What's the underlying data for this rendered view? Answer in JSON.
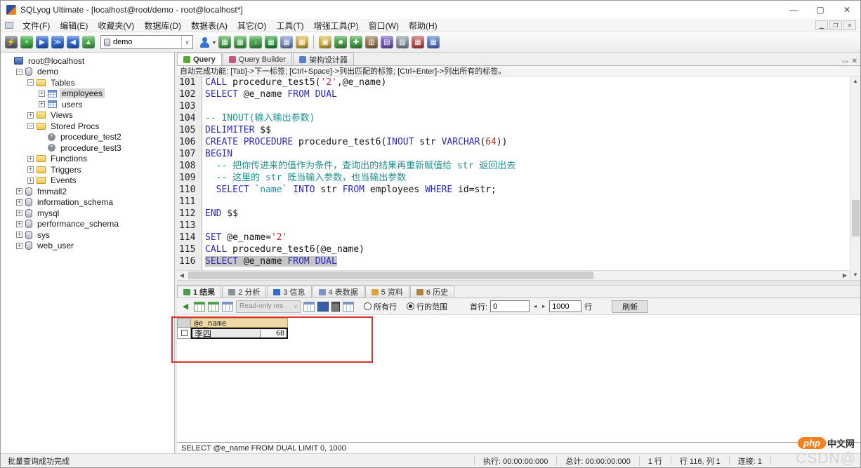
{
  "colors": {
    "keyword": "#2a2ac4",
    "string": "#cc2b2b",
    "number": "#99332b",
    "comment": "#1d8f8f",
    "backtick": "#1d8f8f",
    "selection_bg": "#c6c6c6",
    "grid_header_bg": "#f0d9a8",
    "annotation_red": "#d9342e",
    "php_orange": "#f4801f"
  },
  "titlebar": {
    "title": "SQLyog Ultimate - [localhost@root/demo - root@localhost*]",
    "controls": {
      "minimize": "—",
      "maximize": "▢",
      "close": "✕"
    }
  },
  "menubar": {
    "items": [
      "文件(F)",
      "编辑(E)",
      "收藏夹(V)",
      "数据库(D)",
      "数据表(A)",
      "其它(O)",
      "工具(T)",
      "增强工具(P)",
      "窗口(W)",
      "帮助(H)"
    ],
    "mdi_controls": [
      "▁",
      "❐",
      "✕"
    ]
  },
  "toolbar": {
    "db_selector_value": "demo",
    "icons_left": [
      {
        "name": "open-connection-icon",
        "glyph": "⚡",
        "color": "#6b6f77"
      },
      {
        "name": "new-connection-icon",
        "glyph": "+",
        "color": "#3faf46"
      },
      {
        "name": "execute-query-icon",
        "glyph": "▶",
        "color": "#2f6bd8"
      },
      {
        "name": "execute-all-icon",
        "glyph": "≫",
        "color": "#2f6bd8"
      },
      {
        "name": "refresh-icon",
        "glyph": "◀",
        "color": "#2f6bd8"
      },
      {
        "name": "chart-icon",
        "glyph": "▲",
        "color": "#4caf50"
      }
    ],
    "icons_mid": [
      {
        "name": "insert-row-icon",
        "glyph": "▦",
        "color": "#49a84d"
      },
      {
        "name": "duplicate-row-icon",
        "glyph": "▦",
        "color": "#49a84d"
      },
      {
        "name": "import-icon",
        "glyph": "↓",
        "color": "#49a84d"
      },
      {
        "name": "export-table-icon",
        "glyph": "▦",
        "color": "#2e9e44"
      },
      {
        "name": "table-grid-icon",
        "glyph": "▦",
        "color": "#7d93c6"
      },
      {
        "name": "schema-grid-icon",
        "glyph": "▦",
        "color": "#d8b74a"
      }
    ],
    "icons_right": [
      {
        "name": "backup-icon",
        "glyph": "▣",
        "color": "#d8b74a"
      },
      {
        "name": "user-manager-icon",
        "glyph": "☻",
        "color": "#49a84d"
      },
      {
        "name": "sync-icon",
        "glyph": "✚",
        "color": "#49a84d"
      },
      {
        "name": "migrate-icon",
        "glyph": "▥",
        "color": "#9a7b4f"
      },
      {
        "name": "scheduler-icon",
        "glyph": "▤",
        "color": "#7a5fc0"
      },
      {
        "name": "snapshot-icon",
        "glyph": "▧",
        "color": "#8d9aa5"
      },
      {
        "name": "format-icon",
        "glyph": "▦",
        "color": "#c05555"
      },
      {
        "name": "compare-icon",
        "glyph": "▦",
        "color": "#5b7fd0"
      }
    ]
  },
  "sidebar": {
    "tree": [
      {
        "label": "root@localhost",
        "level": 0,
        "icon": "server",
        "expand": ""
      },
      {
        "label": "demo",
        "level": 1,
        "icon": "db",
        "expand": "-"
      },
      {
        "label": "Tables",
        "level": 2,
        "icon": "folder",
        "expand": "-"
      },
      {
        "label": "employees",
        "level": 3,
        "icon": "table",
        "expand": "+",
        "selected": true
      },
      {
        "label": "users",
        "level": 3,
        "icon": "table",
        "expand": "+"
      },
      {
        "label": "Views",
        "level": 2,
        "icon": "folder",
        "expand": "+"
      },
      {
        "label": "Stored Procs",
        "level": 2,
        "icon": "folder",
        "expand": "-"
      },
      {
        "label": "procedure_test2",
        "level": 3,
        "icon": "proc",
        "expand": ""
      },
      {
        "label": "procedure_test3",
        "level": 3,
        "icon": "proc",
        "expand": ""
      },
      {
        "label": "Functions",
        "level": 2,
        "icon": "folder",
        "expand": "+"
      },
      {
        "label": "Triggers",
        "level": 2,
        "icon": "folder",
        "expand": "+"
      },
      {
        "label": "Events",
        "level": 2,
        "icon": "folder",
        "expand": "+"
      },
      {
        "label": "fmmall2",
        "level": 1,
        "icon": "db",
        "expand": "+"
      },
      {
        "label": "information_schema",
        "level": 1,
        "icon": "db",
        "expand": "+"
      },
      {
        "label": "mysql",
        "level": 1,
        "icon": "db",
        "expand": "+"
      },
      {
        "label": "performance_schema",
        "level": 1,
        "icon": "db",
        "expand": "+"
      },
      {
        "label": "sys",
        "level": 1,
        "icon": "db",
        "expand": "+"
      },
      {
        "label": "web_user",
        "level": 1,
        "icon": "db",
        "expand": "+"
      }
    ]
  },
  "query_tabs": {
    "tabs": [
      {
        "label": "Query",
        "icon": "query-icon",
        "icon_color": "#58a832",
        "active": true
      },
      {
        "label": "Query Builder",
        "icon": "query-builder-icon",
        "icon_color": "#c45b7a",
        "active": false
      },
      {
        "label": "架构设计器",
        "icon": "schema-designer-icon",
        "icon_color": "#5b7fd0",
        "active": false
      }
    ],
    "close_glyph": "✕",
    "nav_glyphs": "◂ ▸"
  },
  "hint": "自动完成功能: [Tab]->下一标签; [Ctrl+Space]->列出匹配的标签; [Ctrl+Enter]->列出所有的标签。",
  "editor": {
    "lines": [
      {
        "num": "101",
        "segs": [
          {
            "t": "CALL",
            "c": "kw"
          },
          {
            "t": " procedure_test5(",
            "c": "pl"
          },
          {
            "t": "'2'",
            "c": "str"
          },
          {
            "t": ",@e_name)",
            "c": "pl"
          }
        ]
      },
      {
        "num": "102",
        "segs": [
          {
            "t": "SELECT",
            "c": "kw"
          },
          {
            "t": " @e_name ",
            "c": "pl"
          },
          {
            "t": "FROM",
            "c": "kw"
          },
          {
            "t": " ",
            "c": "pl"
          },
          {
            "t": "DUAL",
            "c": "kw"
          }
        ]
      },
      {
        "num": "103",
        "segs": []
      },
      {
        "num": "104",
        "segs": [
          {
            "t": "-- INOUT(输入输出参数)",
            "c": "com"
          }
        ]
      },
      {
        "num": "105",
        "segs": [
          {
            "t": "DELIMITER",
            "c": "kw"
          },
          {
            "t": " $$",
            "c": "pl"
          }
        ]
      },
      {
        "num": "106",
        "segs": [
          {
            "t": "CREATE PROCEDURE",
            "c": "kw"
          },
          {
            "t": " procedure_test6(",
            "c": "pl"
          },
          {
            "t": "INOUT",
            "c": "kw"
          },
          {
            "t": " str ",
            "c": "pl"
          },
          {
            "t": "VARCHAR",
            "c": "kw"
          },
          {
            "t": "(",
            "c": "pl"
          },
          {
            "t": "64",
            "c": "num"
          },
          {
            "t": "))",
            "c": "pl"
          }
        ]
      },
      {
        "num": "107",
        "segs": [
          {
            "t": "BEGIN",
            "c": "kw"
          }
        ]
      },
      {
        "num": "108",
        "segs": [
          {
            "t": "  -- 把你传进来的值作为条件，查询出的结果再重新赋值给 str 返回出去",
            "c": "com"
          }
        ]
      },
      {
        "num": "109",
        "segs": [
          {
            "t": "  -- 这里的 str 既当输入参数，也当输出参数",
            "c": "com"
          }
        ]
      },
      {
        "num": "110",
        "segs": [
          {
            "t": "  ",
            "c": "pl"
          },
          {
            "t": "SELECT",
            "c": "kw"
          },
          {
            "t": " ",
            "c": "pl"
          },
          {
            "t": "`name`",
            "c": "tick"
          },
          {
            "t": " ",
            "c": "pl"
          },
          {
            "t": "INTO",
            "c": "kw"
          },
          {
            "t": " str ",
            "c": "pl"
          },
          {
            "t": "FROM",
            "c": "kw"
          },
          {
            "t": " employees ",
            "c": "pl"
          },
          {
            "t": "WHERE",
            "c": "kw"
          },
          {
            "t": " id=str;",
            "c": "pl"
          }
        ]
      },
      {
        "num": "111",
        "segs": []
      },
      {
        "num": "112",
        "segs": [
          {
            "t": "END",
            "c": "kw"
          },
          {
            "t": " $$",
            "c": "pl"
          }
        ]
      },
      {
        "num": "113",
        "segs": []
      },
      {
        "num": "114",
        "segs": [
          {
            "t": "SET",
            "c": "kw"
          },
          {
            "t": " @e_name=",
            "c": "pl"
          },
          {
            "t": "'2'",
            "c": "str"
          }
        ]
      },
      {
        "num": "115",
        "segs": [
          {
            "t": "CALL",
            "c": "kw"
          },
          {
            "t": " procedure_test6(@e_name)",
            "c": "pl"
          }
        ]
      },
      {
        "num": "116",
        "selected": true,
        "segs": [
          {
            "t": "SELECT",
            "c": "kw"
          },
          {
            "t": " @e_name ",
            "c": "pl"
          },
          {
            "t": "FROM",
            "c": "kw"
          },
          {
            "t": " ",
            "c": "pl"
          },
          {
            "t": "DUAL",
            "c": "kw"
          }
        ]
      }
    ]
  },
  "result_tabs": [
    {
      "label": "1 结果",
      "icon": "result-grid-icon",
      "icon_color": "#4a9e4d",
      "active": true
    },
    {
      "label": "2 分析",
      "icon": "analyze-icon",
      "icon_color": "#8a8f96",
      "active": false
    },
    {
      "label": "3 信息",
      "icon": "info-icon",
      "icon_color": "#2f6bd8",
      "active": false
    },
    {
      "label": "4 表数据",
      "icon": "table-data-icon",
      "icon_color": "#7d93c6",
      "active": false
    },
    {
      "label": "5 资料",
      "icon": "profile-icon",
      "icon_color": "#e0a23c",
      "active": false
    },
    {
      "label": "6 历史",
      "icon": "history-icon",
      "icon_color": "#b0843c",
      "active": false
    }
  ],
  "result_toolbar": {
    "readonly_label": "Read-only res",
    "readonly_caret": "∨",
    "radio_all_label": "所有行",
    "radio_all_checked": false,
    "radio_range_label": "行的范围",
    "radio_range_checked": true,
    "first_row_label": "首行:",
    "first_row_value": "0",
    "spin_left": "◂",
    "spin_right": "▸",
    "page_rows_value": "1000",
    "rows_suffix_label": "行",
    "refresh_label": "刷新"
  },
  "result_grid": {
    "columns": [
      "@e_name"
    ],
    "rows": [
      {
        "checked": false,
        "value": "李四",
        "byte_size": "6B",
        "selected": true
      }
    ]
  },
  "query_status": "SELECT @e_name FROM DUAL   LIMIT 0, 1000",
  "statusbar": {
    "message": "批量查询成功完成",
    "cells": [
      "执行: 00:00:00:000",
      "总计: 00:00:00:000",
      "1 行",
      "行 116, 列 1",
      "连接: 1"
    ]
  },
  "watermark": {
    "brand_text": "php",
    "brand_suffix": "中文网",
    "csdn_text": "CSDN@"
  }
}
